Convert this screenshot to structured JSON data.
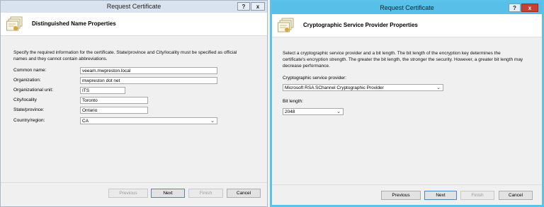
{
  "left": {
    "title": "Request Certificate",
    "help_button": "?",
    "close_button": "x",
    "header_title": "Distinguished Name Properties",
    "description": "Specify the required information for the certificate. State/province and City/locality must be specified as official names and they cannot contain abbreviations.",
    "fields": {
      "common_name": {
        "label": "Common name:",
        "value": "veeam.mwpreston.local"
      },
      "organization": {
        "label": "Organization:",
        "value": "mwpreston dot net"
      },
      "org_unit": {
        "label": "Organizational unit:",
        "value": "ITS"
      },
      "city": {
        "label": "City/locality",
        "value": "Toronto"
      },
      "state": {
        "label": "State/province:",
        "value": "Ontario"
      },
      "country": {
        "label": "Country/region:",
        "value": "CA"
      }
    },
    "buttons": {
      "previous": "Previous",
      "next": "Next",
      "finish": "Finish",
      "cancel": "Cancel"
    }
  },
  "right": {
    "title": "Request Certificate",
    "help_button": "?",
    "close_button": "x",
    "header_title": "Cryptographic Service Provider Properties",
    "description": "Select a cryptographic service provider and a bit length. The bit length of the encryption key determines the certificate's encryption strength. The greater the bit length, the stronger the security. However, a greater bit length may decrease performance.",
    "csp_label": "Cryptographic service provider:",
    "csp_value": "Microsoft RSA SChannel Cryptographic Provider",
    "bit_label": "Bit length:",
    "bit_value": "2048",
    "buttons": {
      "previous": "Previous",
      "next": "Next",
      "finish": "Finish",
      "cancel": "Cancel"
    }
  },
  "colors": {
    "active_title": "#57c0e9",
    "inactive_title": "#d8e3ef",
    "close_red": "#c84031"
  },
  "icons": {
    "header": "certificate-icon",
    "dropdown": "chevron-down-icon"
  }
}
